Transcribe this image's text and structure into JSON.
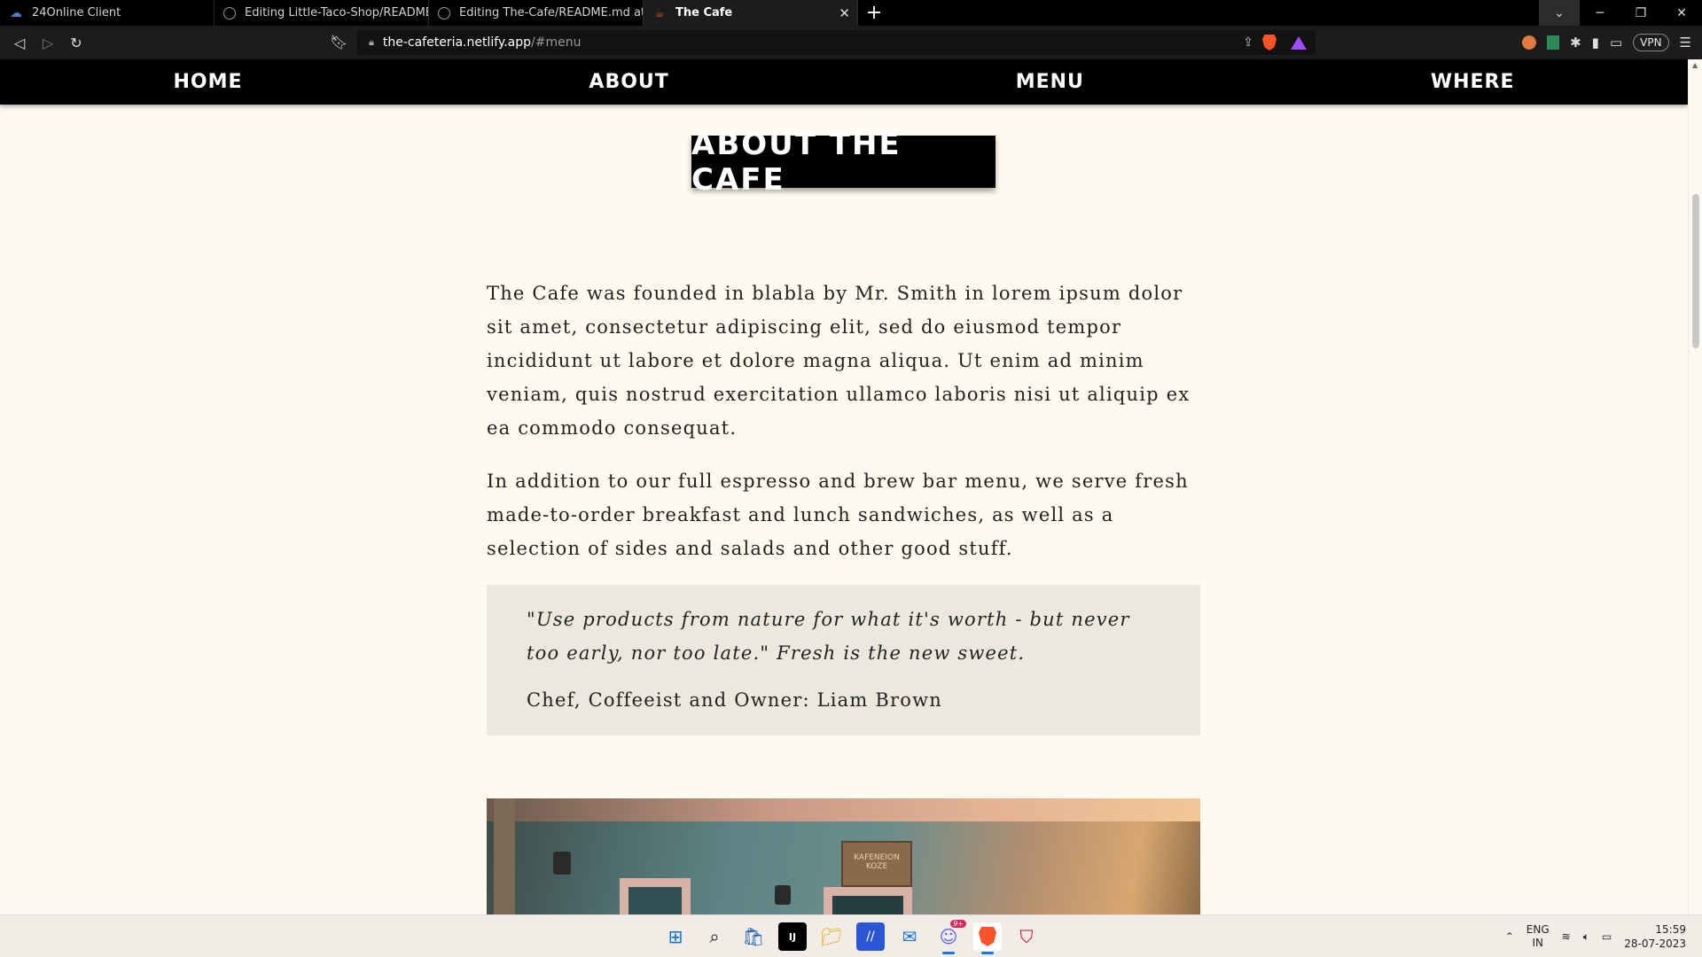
{
  "browser": {
    "tabs": [
      {
        "title": "24Online Client",
        "icon": "cloud-icon"
      },
      {
        "title": "Editing Little-Taco-Shop/README.md",
        "icon": "github-icon"
      },
      {
        "title": "Editing The-Cafe/README.md at main",
        "icon": "github-icon"
      },
      {
        "title": "The Cafe",
        "icon": "cafe-icon",
        "active": true
      }
    ],
    "url_host": "the-cafeteria.netlify.app",
    "url_path": "/#menu",
    "vpn_label": "VPN"
  },
  "site": {
    "nav": [
      "HOME",
      "ABOUT",
      "MENU",
      "WHERE"
    ],
    "section_title": "ABOUT THE CAFE",
    "paragraphs": [
      "The Cafe was founded in blabla by Mr. Smith in lorem ipsum dolor sit amet, consectetur adipiscing elit, sed do eiusmod tempor incididunt ut labore et dolore magna aliqua. Ut enim ad minim veniam, quis nostrud exercitation ullamco laboris nisi ut aliquip ex ea commodo consequat.",
      "In addition to our full espresso and brew bar menu, we serve fresh made-to-order breakfast and lunch sandwiches, as well as a selection of sides and salads and other good stuff."
    ],
    "quote": "\"Use products from nature for what it's worth - but never too early, nor too late.\" Fresh is the new sweet.",
    "quote_author": "Chef, Coffeeist and Owner: Liam Brown",
    "photo_sign": "KAFENEION KOZE"
  },
  "taskbar": {
    "discord_badge": "9+",
    "lang_top": "ENG",
    "lang_bottom": "IN",
    "time": "15:59",
    "date": "28-07-2023"
  },
  "colors": {
    "page_bg": "#fffaf0",
    "nav_bg": "#000000",
    "quote_bg": "#ebe9de"
  }
}
